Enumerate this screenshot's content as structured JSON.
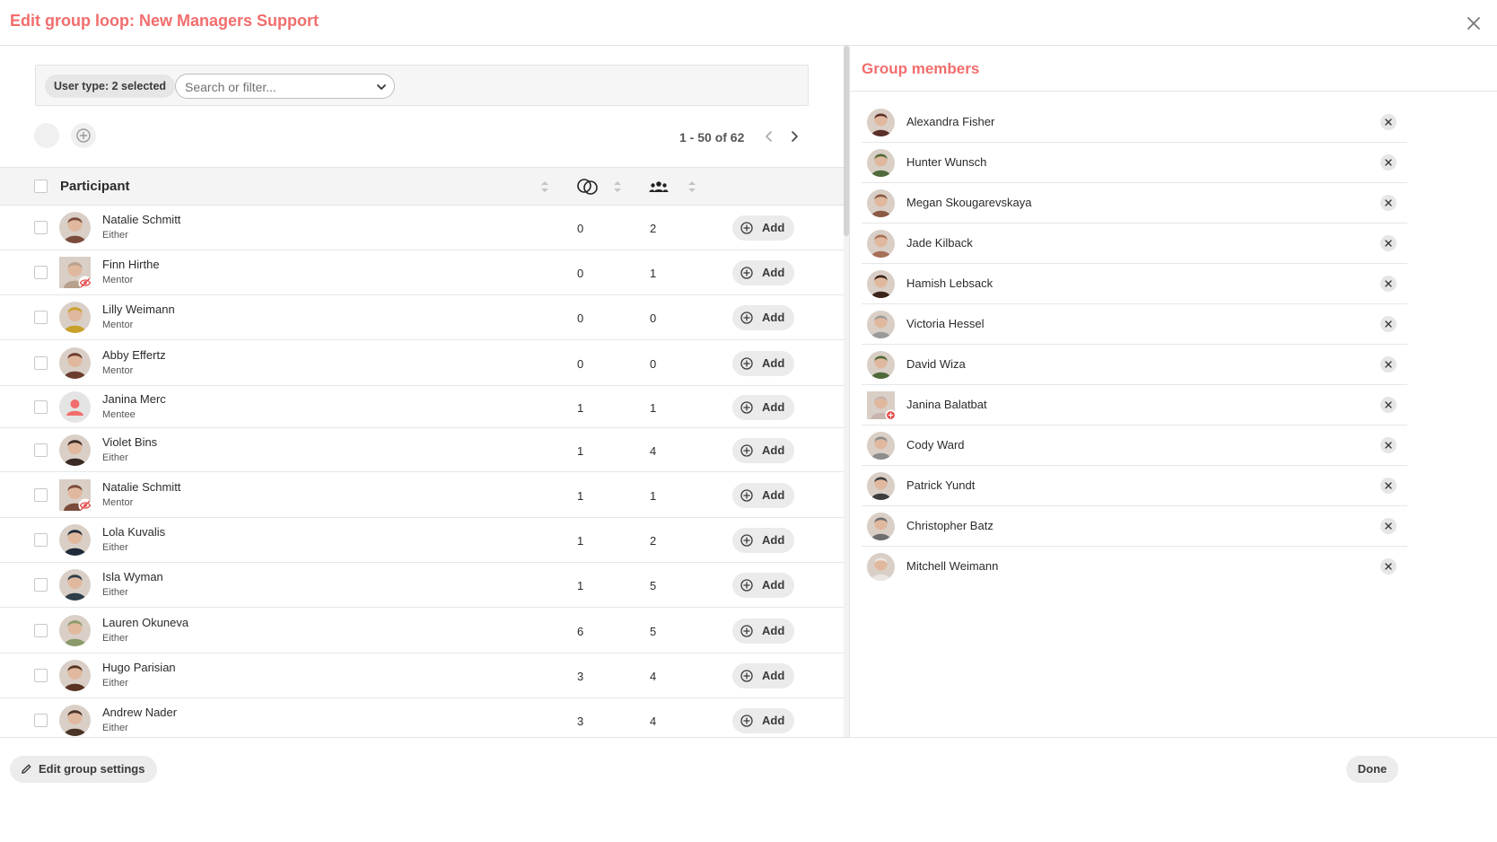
{
  "header": {
    "title": "Edit group loop: New Managers Support"
  },
  "colors": {
    "accent": "#f26d6d",
    "badge": "#e24b4b"
  },
  "filter": {
    "chip_label": "User type: 2 selected",
    "search_placeholder": "Search or filter..."
  },
  "pagination": {
    "range_text": "1 - 50 of 62"
  },
  "table": {
    "participant_header": "Participant",
    "loops_column_icon": "linked-circles-icon",
    "groups_column_icon": "people-group-icon",
    "add_label": "Add",
    "rows": [
      {
        "name": "Natalie Schmitt",
        "role": "Either",
        "loops": "0",
        "groups": "2",
        "avatar": "#7a4a3a",
        "hidden": false
      },
      {
        "name": "Finn Hirthe",
        "role": "Mentor",
        "loops": "0",
        "groups": "1",
        "avatar": "#b7a08c",
        "hidden": true
      },
      {
        "name": "Lilly Weimann",
        "role": "Mentor",
        "loops": "0",
        "groups": "0",
        "avatar": "#c9a12a",
        "hidden": false
      },
      {
        "name": "Abby Effertz",
        "role": "Mentor",
        "loops": "0",
        "groups": "0",
        "avatar": "#6b3d2e",
        "hidden": false
      },
      {
        "name": "Janina Merc",
        "role": "Mentee",
        "loops": "1",
        "groups": "1",
        "avatar": "placeholder",
        "hidden": false
      },
      {
        "name": "Violet Bins",
        "role": "Either",
        "loops": "1",
        "groups": "4",
        "avatar": "#3a2a24",
        "hidden": false
      },
      {
        "name": "Natalie Schmitt",
        "role": "Mentor",
        "loops": "1",
        "groups": "1",
        "avatar": "#7a4a3a",
        "hidden": true
      },
      {
        "name": "Lola Kuvalis",
        "role": "Either",
        "loops": "1",
        "groups": "2",
        "avatar": "#1f2a3a",
        "hidden": false
      },
      {
        "name": "Isla Wyman",
        "role": "Either",
        "loops": "1",
        "groups": "5",
        "avatar": "#2e3f4a",
        "hidden": false
      },
      {
        "name": "Lauren Okuneva",
        "role": "Either",
        "loops": "6",
        "groups": "5",
        "avatar": "#8b9a6a",
        "hidden": false
      },
      {
        "name": "Hugo Parisian",
        "role": "Either",
        "loops": "3",
        "groups": "4",
        "avatar": "#5a3422",
        "hidden": false
      },
      {
        "name": "Andrew Nader",
        "role": "Either",
        "loops": "3",
        "groups": "4",
        "avatar": "#4a3428",
        "hidden": false
      }
    ]
  },
  "members": {
    "title": "Group members",
    "items": [
      {
        "name": "Alexandra Fisher",
        "avatar": "#5b2f2a",
        "badge": false
      },
      {
        "name": "Hunter Wunsch",
        "avatar": "#4f6a3a",
        "badge": false
      },
      {
        "name": "Megan Skougarevskaya",
        "avatar": "#8a5a46",
        "badge": false
      },
      {
        "name": "Jade Kilback",
        "avatar": "#a66f58",
        "badge": false
      },
      {
        "name": "Hamish Lebsack",
        "avatar": "#3b2418",
        "badge": false
      },
      {
        "name": "Victoria Hessel",
        "avatar": "#9a9a9a",
        "badge": false
      },
      {
        "name": "David Wiza",
        "avatar": "#4f6a3a",
        "badge": false
      },
      {
        "name": "Janina Balatbat",
        "avatar": "#c8b4b0",
        "badge": true
      },
      {
        "name": "Cody Ward",
        "avatar": "#8d8d8d",
        "badge": false
      },
      {
        "name": "Patrick Yundt",
        "avatar": "#3d3d3d",
        "badge": false
      },
      {
        "name": "Christopher Batz",
        "avatar": "#6e6e6e",
        "badge": false
      },
      {
        "name": "Mitchell Weimann",
        "avatar": "#e9e5e2",
        "badge": false
      }
    ]
  },
  "footer": {
    "edit_settings_label": "Edit group settings",
    "done_label": "Done"
  }
}
